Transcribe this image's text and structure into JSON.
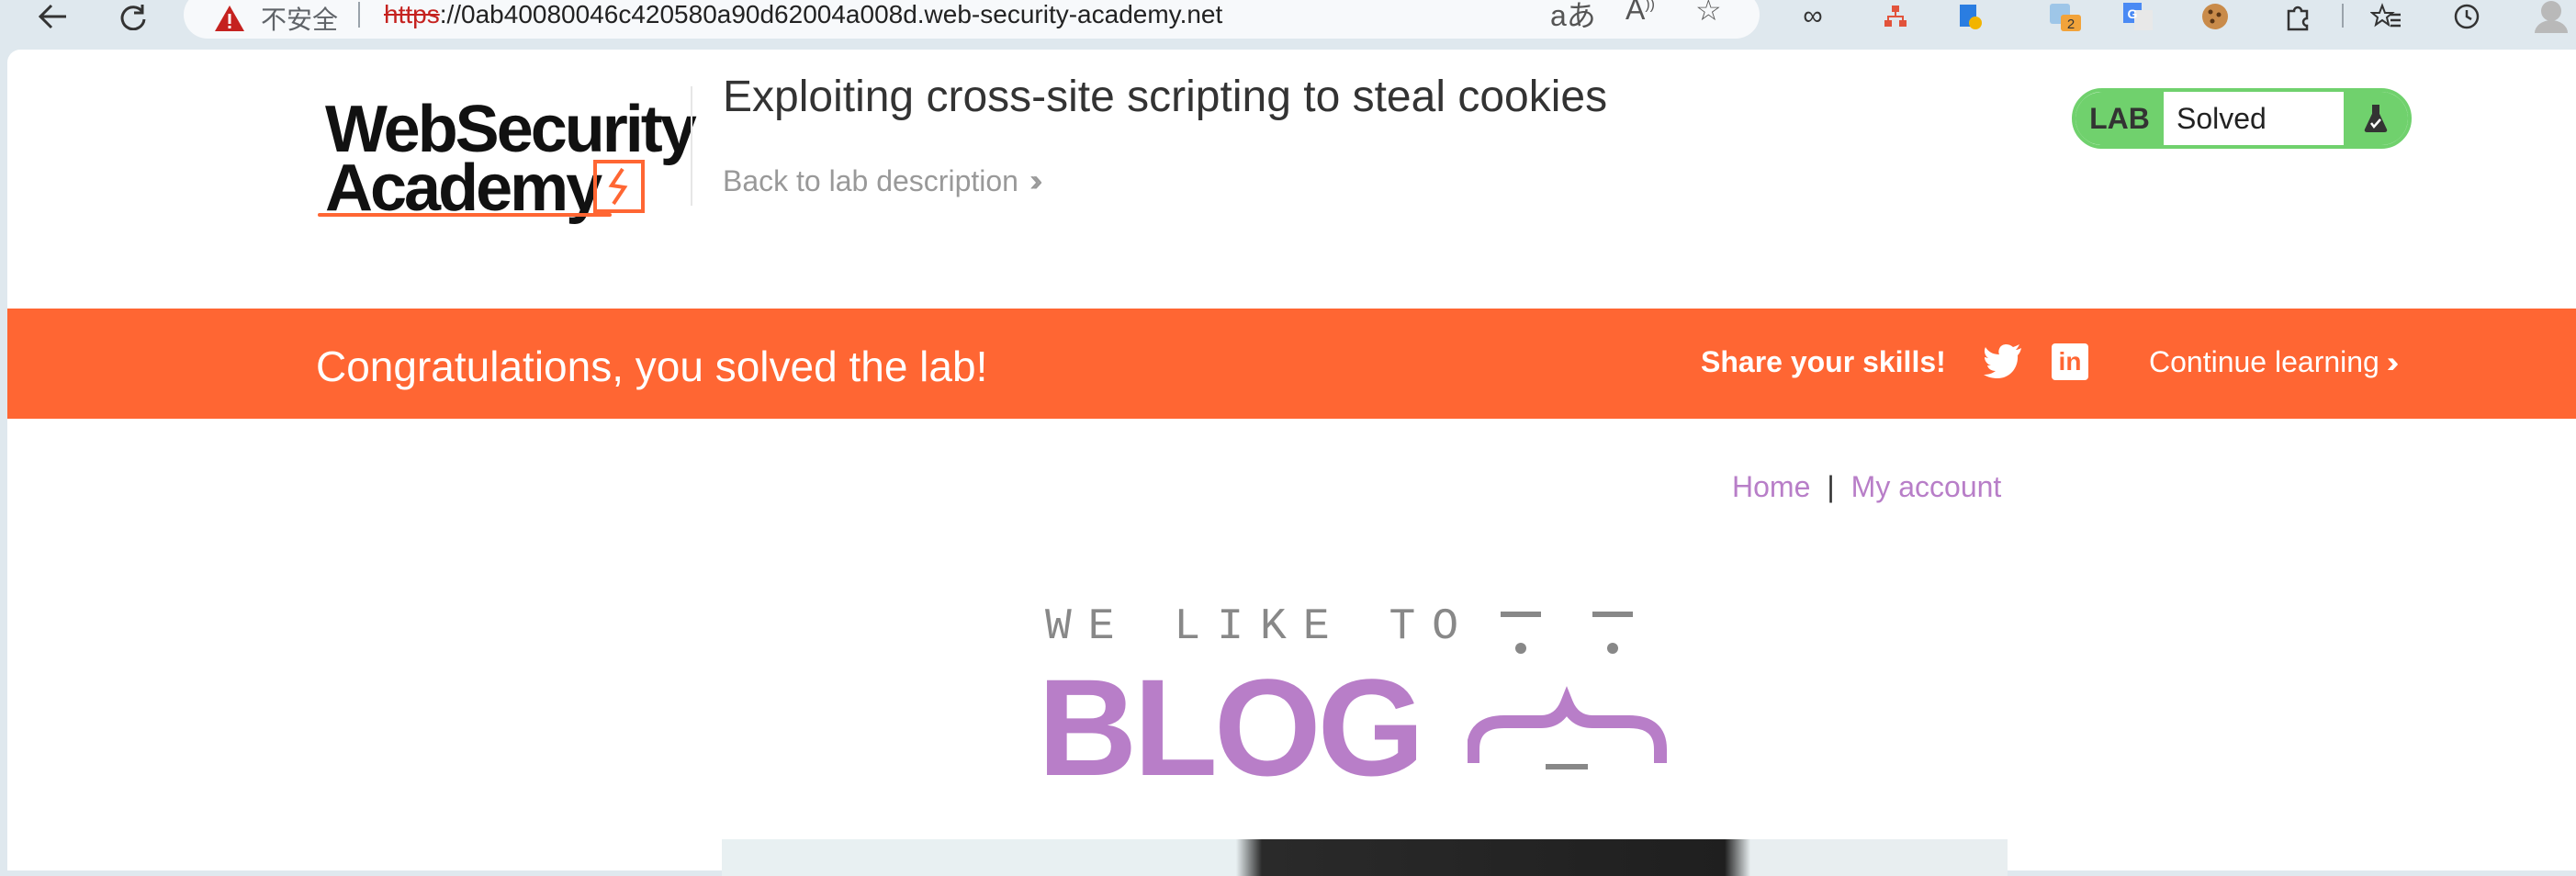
{
  "browser": {
    "insecure_label": "不安全",
    "url_scheme": "https",
    "url_rest": "://0ab40080046c420580a90d62004a008d.web-security-academy.net",
    "extension_badge": "2"
  },
  "header": {
    "logo_line1": "WebSecurity",
    "logo_line2": "Academy",
    "lab_title": "Exploiting cross-site scripting to steal cookies",
    "back_link": "Back to lab description",
    "status_tag": "LAB",
    "status_text": "Solved"
  },
  "banner": {
    "message": "Congratulations, you solved the lab!",
    "share_label": "Share your skills!",
    "continue_label": "Continue learning"
  },
  "nav": {
    "home": "Home",
    "separator": "|",
    "account": "My account"
  },
  "blog_banner": {
    "tagline": "WE LIKE TO",
    "word": "BLOG"
  },
  "colors": {
    "accent_orange": "#ff6633",
    "status_green": "#70d16d",
    "link_purple": "#b87ec8"
  }
}
